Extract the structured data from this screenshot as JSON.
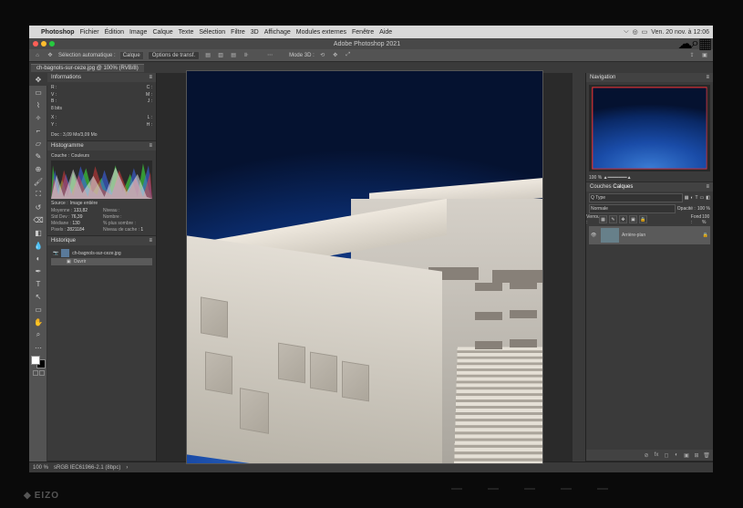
{
  "menubar": {
    "apple": "",
    "app": "Photoshop",
    "items": [
      "Fichier",
      "Édition",
      "Image",
      "Calque",
      "Texte",
      "Sélection",
      "Filtre",
      "3D",
      "Affichage",
      "Modules externes",
      "Fenêtre",
      "Aide"
    ],
    "clock": "Ven. 20 nov. à 12:06"
  },
  "titlebar": {
    "title": "Adobe Photoshop 2021"
  },
  "optbar": {
    "selection_auto": "Sélection automatique :",
    "layer_dropdown": "Calque",
    "transform_controls": "Options de transf.",
    "mode3d": "Mode 3D :"
  },
  "doctab": {
    "label": "ch-bagnols-sur-ceze.jpg @ 100% (RVB/8)"
  },
  "panels": {
    "info": {
      "title": "Informations",
      "bits": "8 bits",
      "doc": "Doc : 3,09 Mo/3,09 Mo"
    },
    "histogram": {
      "title": "Histogramme",
      "channel_label": "Couche :",
      "channel_value": "Couleurs",
      "source_label": "Source :",
      "source_value": "Image entière",
      "stats": {
        "mean_l": "Moyenne :",
        "mean_v": "133,82",
        "std_l": "Std Dev :",
        "std_v": "76,39",
        "median_l": "Médiane :",
        "median_v": "130",
        "pixels_l": "Pixels :",
        "pixels_v": "2821184",
        "level_l": "Niveau :",
        "count_l": "Nombre :",
        "pct_l": "% plus sombre :",
        "cache_l": "Niveau de cache :",
        "cache_v": "1"
      }
    },
    "history": {
      "title": "Historique",
      "doc_name": "ch-bagnols-sur-ceze.jpg",
      "step1": "Ouvrir"
    },
    "navigation": {
      "title": "Navigation",
      "zoom": "100 %"
    },
    "layers": {
      "tab1": "Couches",
      "tab2": "Calques",
      "kind": "Q Type",
      "opacity_l": "Opacité :",
      "opacity_v": "100 %",
      "lock_l": "Verrou :",
      "fill_l": "Fond :",
      "fill_v": "100 %",
      "layer_name": "Arrière-plan"
    }
  },
  "statusbar": {
    "zoom": "100 %",
    "profile": "sRGB IEC61966-2.1 (8bpc)"
  },
  "monitor": {
    "brand": "EIZO"
  }
}
